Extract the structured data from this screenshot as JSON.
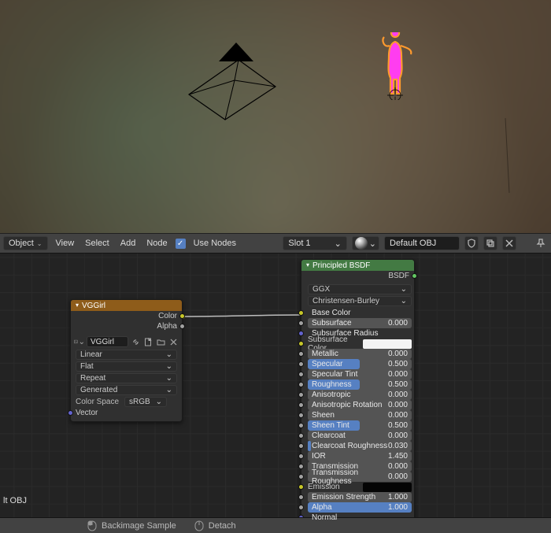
{
  "viewport": {
    "selected_object_hint": "figure-silhouette"
  },
  "header": {
    "object_mode": "Object",
    "menus": {
      "view": "View",
      "select": "Select",
      "add": "Add",
      "node": "Node"
    },
    "use_nodes_label": "Use Nodes",
    "slot": "Slot 1",
    "material": "Default OBJ"
  },
  "overlay": {
    "bottom_left": "lt OBJ"
  },
  "footer": {
    "action_a": "Backimage Sample",
    "action_b": "Detach"
  },
  "nodes": {
    "image_texture": {
      "title": "VGGirl",
      "outputs": {
        "color": "Color",
        "alpha": "Alpha"
      },
      "image_name": "VGGirl",
      "interpolation": "Linear",
      "projection": "Flat",
      "extension": "Repeat",
      "source": "Generated",
      "color_space_label": "Color Space",
      "color_space": "sRGB",
      "inputs": {
        "vector": "Vector"
      }
    },
    "principled": {
      "title": "Principled BSDF",
      "output": "BSDF",
      "distribution": "GGX",
      "subsurface_method": "Christensen-Burley",
      "params": [
        {
          "key": "base_color",
          "label": "Base Color",
          "socket": "color",
          "display": "label"
        },
        {
          "key": "subsurface",
          "label": "Subsurface",
          "socket": "value",
          "display": "slider",
          "value": "0.000",
          "fill": 0.0
        },
        {
          "key": "subsurface_radius",
          "label": "Subsurface Radius",
          "socket": "vector",
          "display": "label"
        },
        {
          "key": "subsurface_color",
          "label": "Subsurface Color",
          "socket": "color",
          "display": "colorfield",
          "swatch": "#f4f4f4"
        },
        {
          "key": "metallic",
          "label": "Metallic",
          "socket": "value",
          "display": "slider",
          "value": "0.000",
          "fill": 0.0
        },
        {
          "key": "specular",
          "label": "Specular",
          "socket": "value",
          "display": "slider",
          "value": "0.500",
          "fill": 0.5
        },
        {
          "key": "specular_tint",
          "label": "Specular Tint",
          "socket": "value",
          "display": "slider",
          "value": "0.000",
          "fill": 0.0
        },
        {
          "key": "roughness",
          "label": "Roughness",
          "socket": "value",
          "display": "slider",
          "value": "0.500",
          "fill": 0.5
        },
        {
          "key": "anisotropic",
          "label": "Anisotropic",
          "socket": "value",
          "display": "slider",
          "value": "0.000",
          "fill": 0.0
        },
        {
          "key": "anisotropic_rotation",
          "label": "Anisotropic Rotation",
          "socket": "value",
          "display": "slider",
          "value": "0.000",
          "fill": 0.0
        },
        {
          "key": "sheen",
          "label": "Sheen",
          "socket": "value",
          "display": "slider",
          "value": "0.000",
          "fill": 0.0
        },
        {
          "key": "sheen_tint",
          "label": "Sheen Tint",
          "socket": "value",
          "display": "slider",
          "value": "0.500",
          "fill": 0.5
        },
        {
          "key": "clearcoat",
          "label": "Clearcoat",
          "socket": "value",
          "display": "slider",
          "value": "0.000",
          "fill": 0.0
        },
        {
          "key": "clearcoat_roughness",
          "label": "Clearcoat Roughness",
          "socket": "value",
          "display": "slider",
          "value": "0.030",
          "fill": 0.03
        },
        {
          "key": "ior",
          "label": "IOR",
          "socket": "value",
          "display": "slider",
          "value": "1.450",
          "fill": 0.0
        },
        {
          "key": "transmission",
          "label": "Transmission",
          "socket": "value",
          "display": "slider",
          "value": "0.000",
          "fill": 0.0
        },
        {
          "key": "transmission_roughness",
          "label": "Transmission Roughness",
          "socket": "value",
          "display": "slider",
          "value": "0.000",
          "fill": 0.0
        },
        {
          "key": "emission",
          "label": "Emission",
          "socket": "color",
          "display": "blackfield"
        },
        {
          "key": "emission_strength",
          "label": "Emission Strength",
          "socket": "value",
          "display": "slider",
          "value": "1.000",
          "fill": 0.0
        },
        {
          "key": "alpha",
          "label": "Alpha",
          "socket": "value",
          "display": "slider",
          "value": "1.000",
          "fill": 1.0
        },
        {
          "key": "normal",
          "label": "Normal",
          "socket": "vector",
          "display": "label"
        }
      ]
    }
  }
}
